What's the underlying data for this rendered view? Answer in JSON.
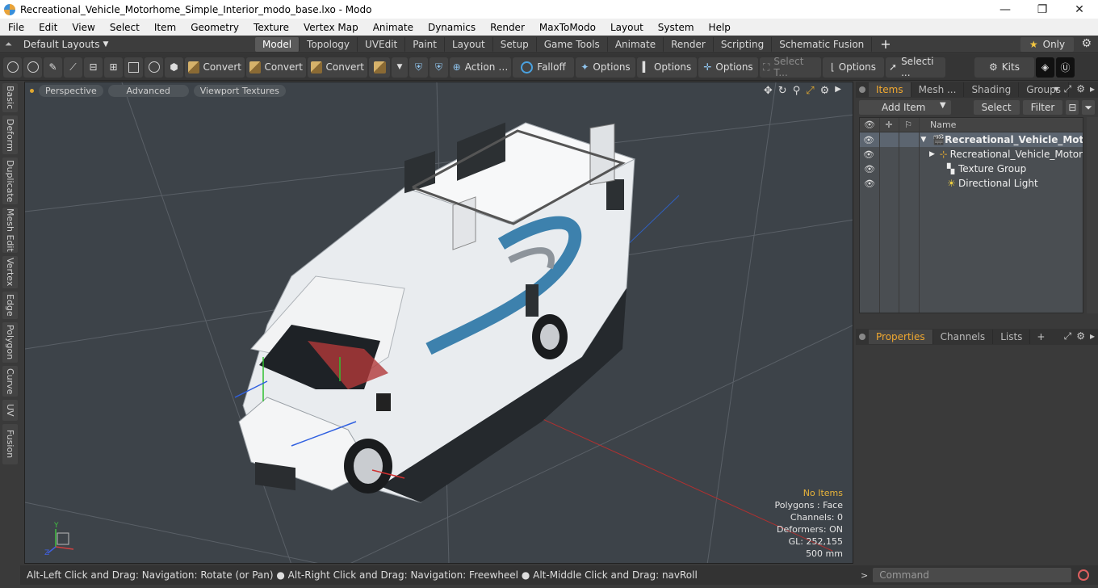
{
  "window": {
    "title": "Recreational_Vehicle_Motorhome_Simple_Interior_modo_base.lxo - Modo"
  },
  "menu": [
    "File",
    "Edit",
    "View",
    "Select",
    "Item",
    "Geometry",
    "Texture",
    "Vertex Map",
    "Animate",
    "Dynamics",
    "Render",
    "MaxToModo",
    "Layout",
    "System",
    "Help"
  ],
  "layoutbar": {
    "layouts_label": "Default Layouts",
    "tabs": [
      "Model",
      "Topology",
      "UVEdit",
      "Paint",
      "Layout",
      "Setup",
      "Game Tools",
      "Animate",
      "Render",
      "Scripting",
      "Schematic Fusion"
    ],
    "active_tab": "Model",
    "only_label": "Only"
  },
  "toolbar": {
    "convert1": "Convert",
    "convert2": "Convert",
    "convert3": "Convert",
    "action": "Action",
    "falloff": "Falloff",
    "options1": "Options",
    "options2": "Options",
    "options3": "Options",
    "select_t": "Select T...",
    "options4": "Options",
    "selecti": "Selecti ...",
    "kits": "Kits"
  },
  "lefttabs": [
    "Basic",
    "Deform",
    "Duplicate",
    "Mesh Edit",
    "Vertex",
    "Edge",
    "Polygon",
    "Curve",
    "UV",
    "Fusion"
  ],
  "viewport": {
    "pills": [
      "Perspective",
      "Advanced",
      "Viewport Textures"
    ],
    "stats": {
      "no_items": "No Items",
      "polygons": "Polygons : Face",
      "channels": "Channels: 0",
      "deformers": "Deformers: ON",
      "gl": "GL: 252,155",
      "scale": "500 mm"
    }
  },
  "status": "Alt-Left Click and Drag: Navigation: Rotate (or Pan) ● Alt-Right Click and Drag: Navigation: Freewheel ● Alt-Middle Click and Drag: navRoll",
  "items_panel": {
    "tabs": [
      "Items",
      "Mesh ...",
      "Shading",
      "Groups"
    ],
    "add_item": "Add Item",
    "select": "Select",
    "filter": "Filter",
    "col_name": "Name",
    "rows": [
      "Recreational_Vehicle_Mot...",
      "Recreational_Vehicle_Motor ...",
      "Texture Group",
      "Directional Light"
    ]
  },
  "props_panel": {
    "tabs": [
      "Properties",
      "Channels",
      "Lists"
    ]
  },
  "command": {
    "placeholder": "Command"
  }
}
